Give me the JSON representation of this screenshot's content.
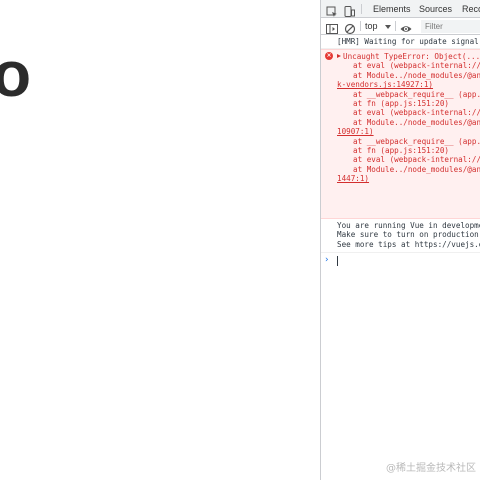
{
  "page": {
    "large_text": "o"
  },
  "devtools": {
    "tabs": [
      {
        "label": "Elements"
      },
      {
        "label": "Sources"
      },
      {
        "label": "Reco"
      }
    ],
    "toolbar": {
      "context": "top",
      "filter_placeholder": "Filter"
    },
    "console": {
      "hmr_log": "[HMR] Waiting for update signal f",
      "error_lines": [
        "Uncaught TypeError: Object(...)",
        "at eval (webpack-internal:///",
        "at Module../node_modules/@ant",
        "k-vendors.js:14927:1)",
        "at __webpack_require__ (app.j",
        "at fn (app.js:151:20)",
        "at eval (webpack-internal:///",
        "at Module../node_modules/@ant",
        "10907:1)",
        "at __webpack_require__ (app.j",
        "at fn (app.js:151:20)",
        "at eval (webpack-internal:///",
        "at Module../node_modules/@ant",
        "1447:1)"
      ],
      "info_lines": [
        "You are running Vue in development",
        "Make sure to turn on production m",
        "See more tips at https://vuejs.or"
      ],
      "prompt_symbol": "›"
    }
  },
  "watermark": "@稀土掘金技术社区",
  "colors": {
    "error_text": "#d32f2f",
    "error_bg": "#fff0f0",
    "toolbar_bg": "#f1f3f4",
    "prompt_accent": "#1a73e8"
  }
}
